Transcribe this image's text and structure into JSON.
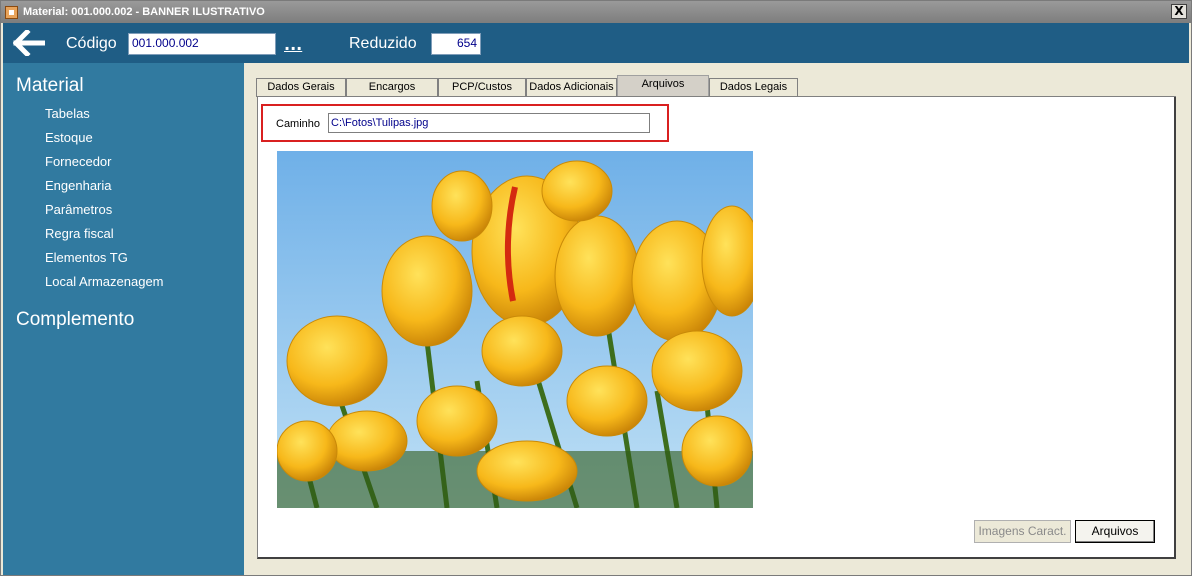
{
  "window": {
    "title": "Material: 001.000.002 - BANNER ILUSTRATIVO",
    "close_label": "X"
  },
  "topbar": {
    "codigo_label": "Código",
    "codigo_value": "001.000.002",
    "more_label": "...",
    "reduzido_label": "Reduzido",
    "reduzido_value": "654"
  },
  "sidebar": {
    "section_material": "Material",
    "items": [
      "Tabelas",
      "Estoque",
      "Fornecedor",
      "Engenharia",
      "Parâmetros",
      "Regra fiscal",
      "Elementos TG",
      "Local Armazenagem"
    ],
    "section_complemento": "Complemento"
  },
  "tabs": [
    {
      "label": "Dados Gerais",
      "active": false
    },
    {
      "label": "Encargos",
      "active": false
    },
    {
      "label": "PCP/Custos",
      "active": false
    },
    {
      "label": "Dados Adicionais",
      "active": false
    },
    {
      "label": "Arquivos",
      "active": true
    },
    {
      "label": "Dados Legais",
      "active": false
    }
  ],
  "arquivos": {
    "caminho_label": "Caminho",
    "caminho_value": "C:\\Fotos\\Tulipas.jpg",
    "image_subject": "yellow tulips photo",
    "btn_imagens": "Imagens Caract.",
    "btn_arquivos": "Arquivos"
  },
  "colors": {
    "topbar": "#1f5d85",
    "sidebar": "#317aa0",
    "highlight": "#d92020"
  }
}
